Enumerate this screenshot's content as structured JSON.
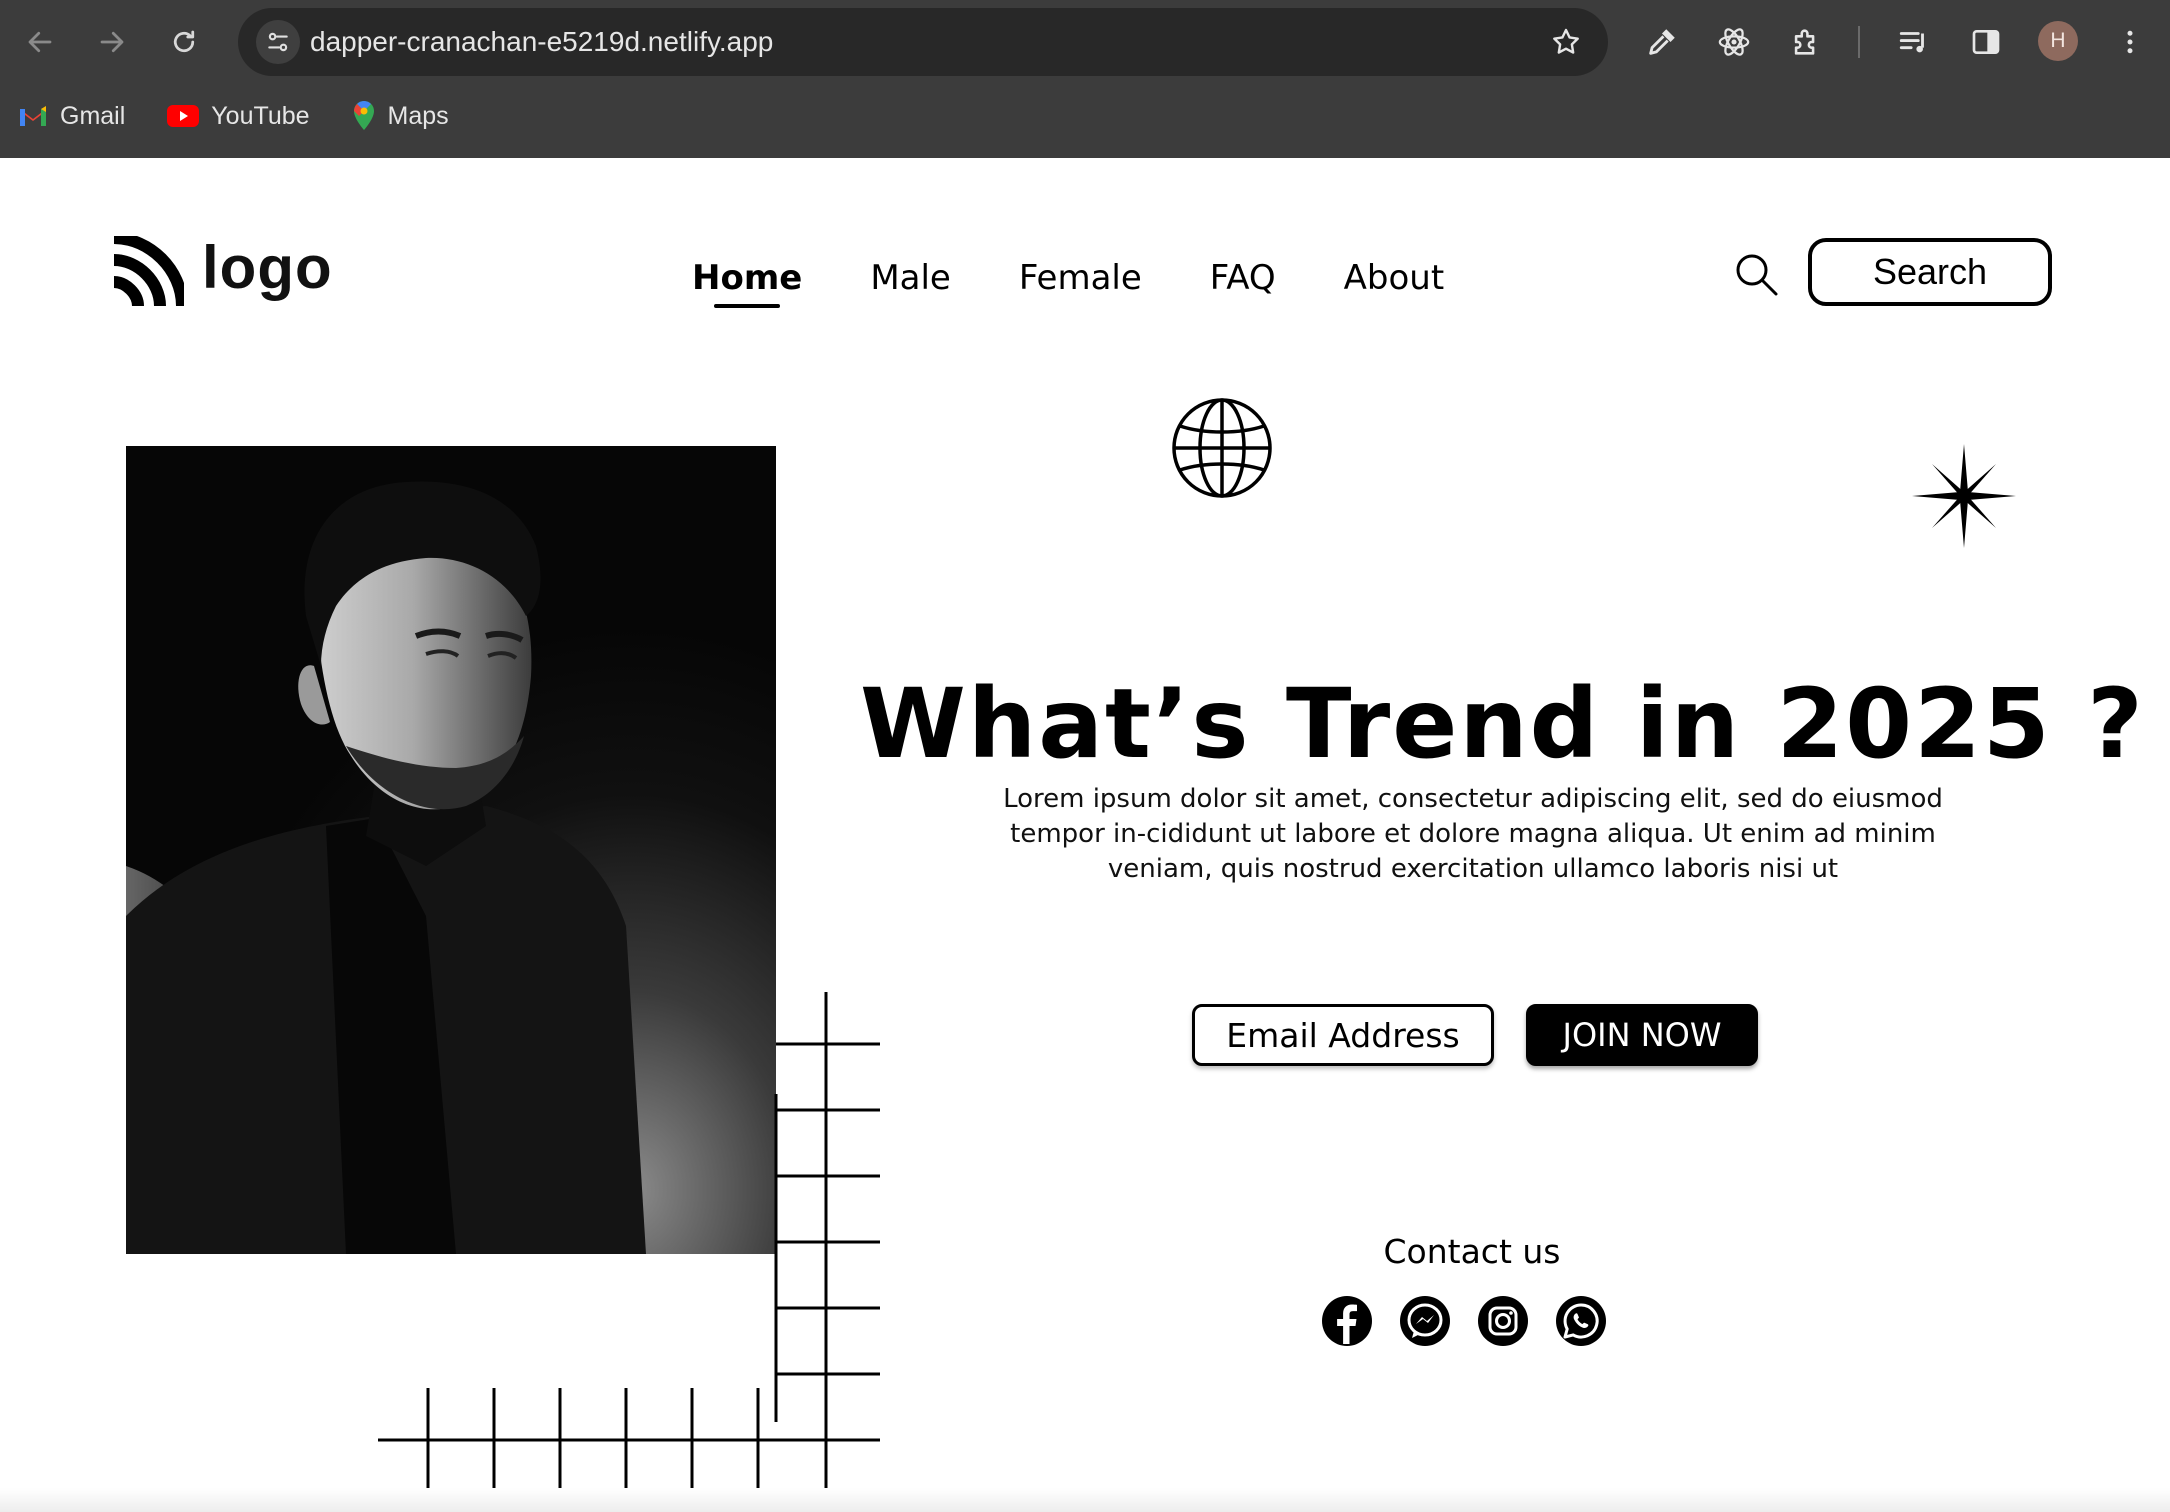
{
  "browser": {
    "url": "dapper-cranachan-e5219d.netlify.app",
    "profile_initial": "H",
    "bookmarks": [
      {
        "label": "Gmail",
        "icon": "gmail-icon"
      },
      {
        "label": "YouTube",
        "icon": "youtube-icon"
      },
      {
        "label": "Maps",
        "icon": "maps-icon"
      }
    ]
  },
  "header": {
    "logo_text": "logo",
    "nav": [
      {
        "label": "Home",
        "active": true
      },
      {
        "label": "Male"
      },
      {
        "label": "Female"
      },
      {
        "label": "FAQ"
      },
      {
        "label": "About"
      }
    ],
    "search_label": "Search"
  },
  "hero": {
    "headline": "What’s Trend in 2025 ?",
    "description": "Lorem ipsum dolor sit amet, consectetur adipiscing elit, sed do eiusmod tempor in-cididunt ut labore et dolore magna aliqua. Ut enim ad minim veniam, quis nostrud exercitation ullamco laboris nisi ut",
    "email_label": "Email Address",
    "join_label": "JOIN NOW"
  },
  "contact": {
    "title": "Contact us",
    "socials": [
      "facebook-icon",
      "messenger-icon",
      "instagram-icon",
      "whatsapp-icon"
    ]
  },
  "colors": {
    "chrome_bg": "#3c3c3c",
    "omnibox_bg": "#282828",
    "page_bg": "#ffffff",
    "ink": "#000000"
  }
}
